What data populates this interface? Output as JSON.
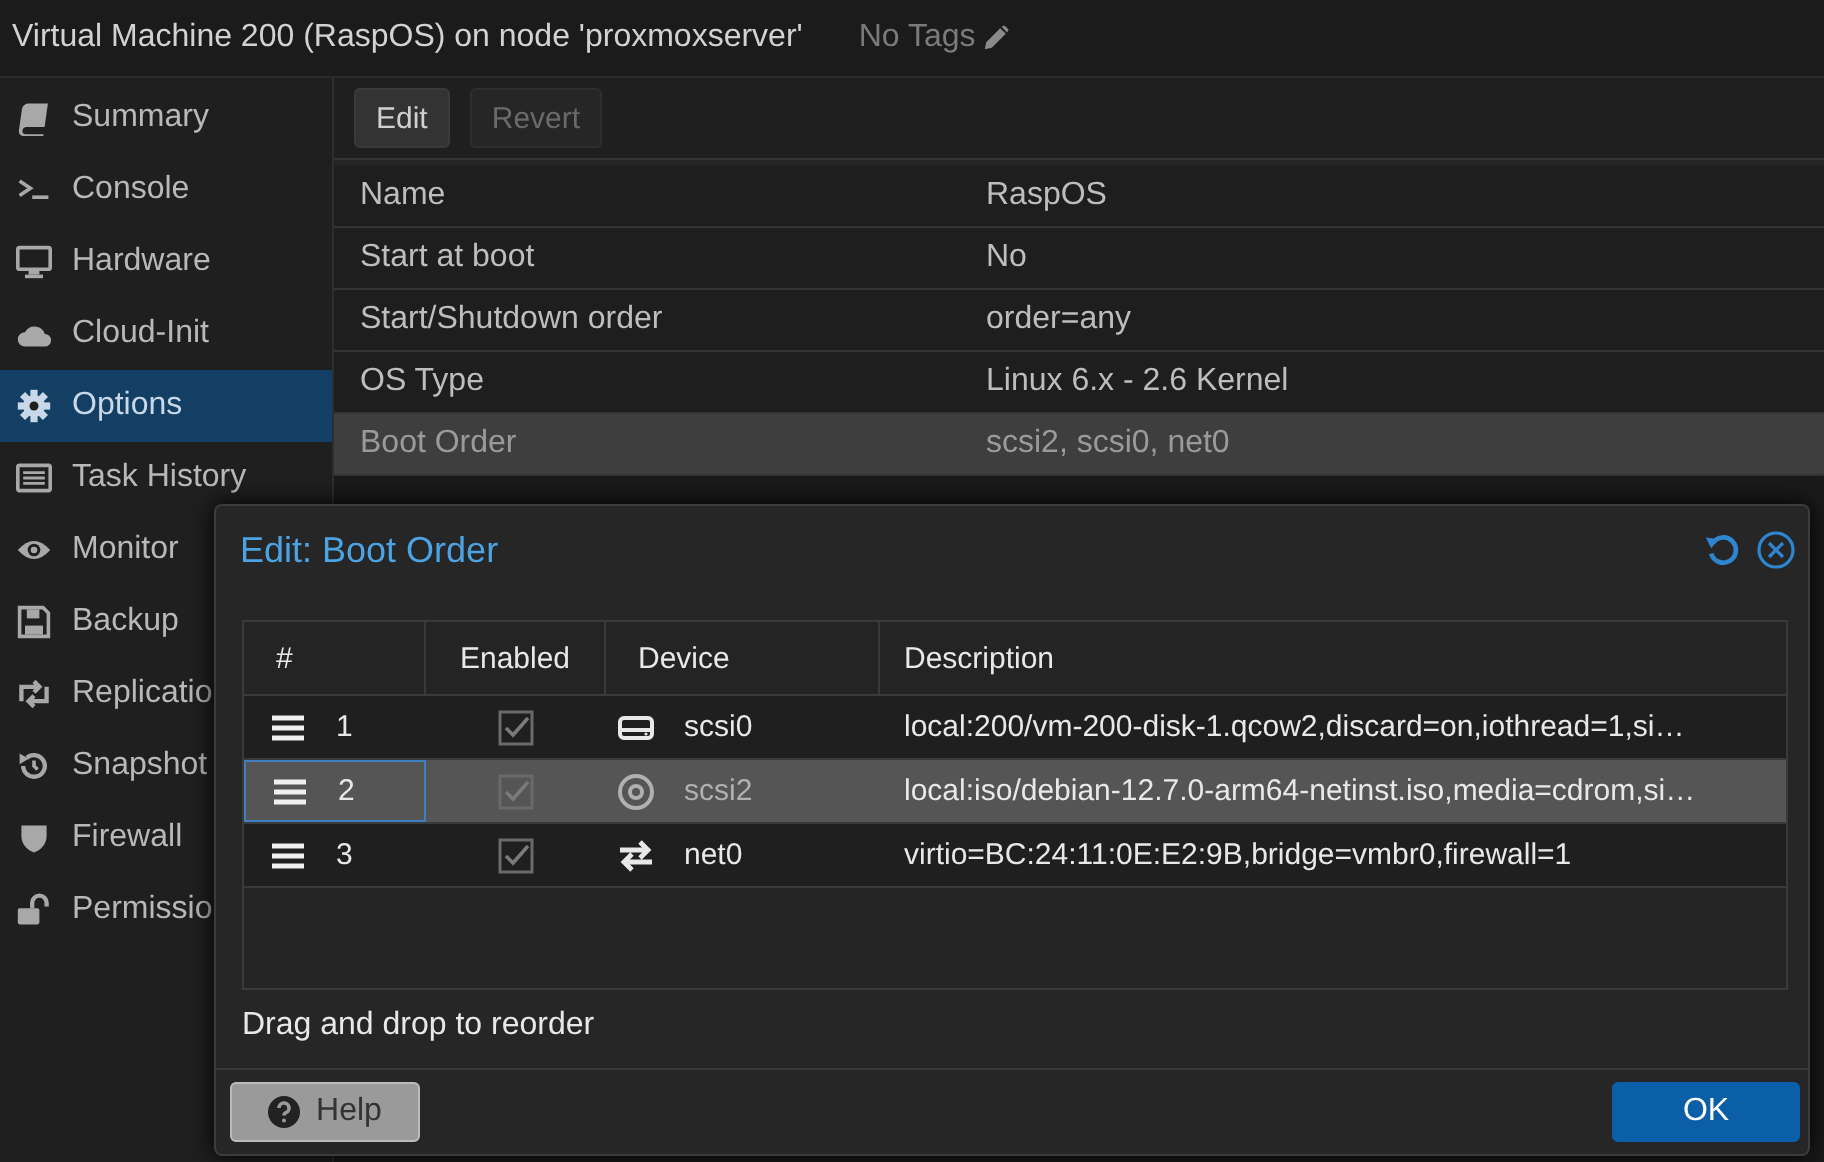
{
  "header": {
    "title": "Virtual Machine 200 (RaspOS) on node 'proxmoxserver'",
    "tags_label": "No Tags"
  },
  "sidebar": {
    "items": [
      {
        "label": "Summary",
        "selected": false
      },
      {
        "label": "Console",
        "selected": false
      },
      {
        "label": "Hardware",
        "selected": false
      },
      {
        "label": "Cloud-Init",
        "selected": false
      },
      {
        "label": "Options",
        "selected": true
      },
      {
        "label": "Task History",
        "selected": false
      },
      {
        "label": "Monitor",
        "selected": false
      },
      {
        "label": "Backup",
        "selected": false
      },
      {
        "label": "Replicatio",
        "selected": false
      },
      {
        "label": "Snapshot",
        "selected": false
      },
      {
        "label": "Firewall",
        "selected": false
      },
      {
        "label": "Permissio",
        "selected": false
      }
    ]
  },
  "toolbar": {
    "buttons": [
      {
        "label": "Edit",
        "disabled": false
      },
      {
        "label": "Revert",
        "disabled": true
      }
    ]
  },
  "options": {
    "rows": [
      {
        "name": "Name",
        "value": "RaspOS",
        "selected": false
      },
      {
        "name": "Start at boot",
        "value": "No",
        "selected": false
      },
      {
        "name": "Start/Shutdown order",
        "value": "order=any",
        "selected": false
      },
      {
        "name": "OS Type",
        "value": "Linux 6.x - 2.6 Kernel",
        "selected": false
      },
      {
        "name": "Boot Order",
        "value": "scsi2, scsi0, net0",
        "selected": true
      }
    ]
  },
  "dialog": {
    "title": "Edit: Boot Order",
    "columns": [
      "#",
      "Enabled",
      "Device",
      "Description"
    ],
    "rows": [
      {
        "number": "1",
        "enabled": true,
        "device": "scsi0",
        "device_muted": false,
        "description": "local:200/vm-200-disk-1.qcow2,discard=on,iothread=1,si…",
        "selected": false
      },
      {
        "number": "2",
        "enabled": true,
        "device": "scsi2",
        "device_muted": true,
        "description": "local:iso/debian-12.7.0-arm64-netinst.iso,media=cdrom,si…",
        "selected": true
      },
      {
        "number": "3",
        "enabled": true,
        "device": "net0",
        "device_muted": false,
        "description": "virtio=BC:24:11:0E:E2:9B,bridge=vmbr0,firewall=1",
        "selected": false
      }
    ],
    "hint": "Drag and drop to reorder",
    "help_button": "Help",
    "ok_button": "OK"
  }
}
